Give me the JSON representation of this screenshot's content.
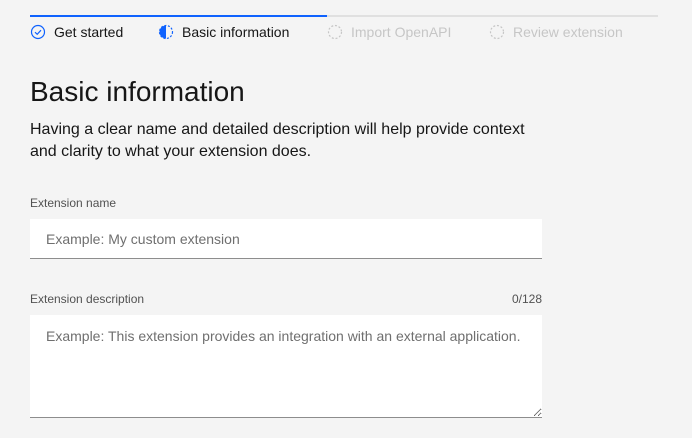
{
  "progress": {
    "steps": [
      {
        "label": "Get started",
        "state": "complete",
        "icon": "checkmark-circle-icon"
      },
      {
        "label": "Basic information",
        "state": "current",
        "icon": "half-filled-circle-icon"
      },
      {
        "label": "Import OpenAPI",
        "state": "incomplete",
        "icon": "dashed-circle-icon"
      },
      {
        "label": "Review extension",
        "state": "incomplete",
        "icon": "dashed-circle-icon"
      }
    ]
  },
  "main": {
    "title": "Basic information",
    "description": "Having a clear name and detailed description will help provide context and clarity to what your extension does."
  },
  "form": {
    "name_label": "Extension name",
    "name_placeholder": "Example: My custom extension",
    "name_value": "",
    "description_label": "Extension description",
    "description_counter": "0/128",
    "description_placeholder": "Example: This extension provides an integration with an external application.",
    "description_value": ""
  },
  "colors": {
    "accent": "#0f62fe",
    "background": "#f4f4f4",
    "field": "#ffffff",
    "incomplete": "#c6c6c6"
  }
}
